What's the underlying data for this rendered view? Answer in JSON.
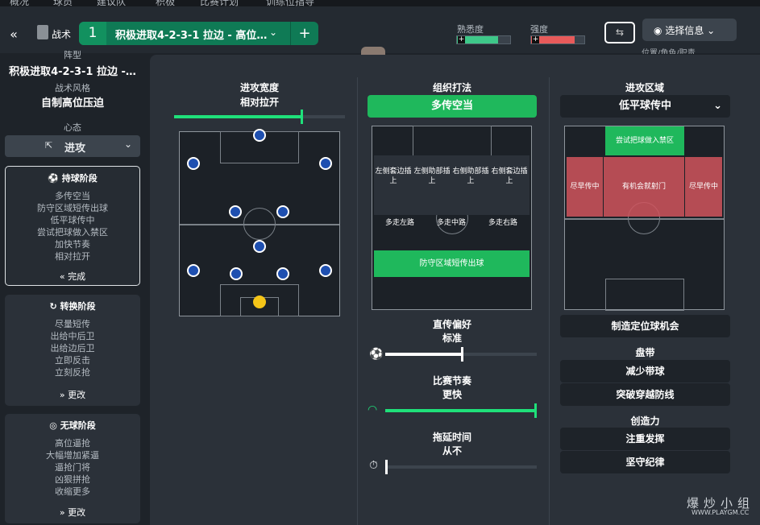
{
  "topnav": [
    "概况",
    "球员",
    "建议队",
    "积极",
    "比赛计划",
    "训练位指导"
  ],
  "toolbar": {
    "tactics_label": "战术",
    "tactic_number": "1",
    "tactic_name": "积极进取4-2-3-1 拉边 - 高位…",
    "familiarity_label": "熟悉度",
    "intensity_label": "强度",
    "select_info_label": "选择信息",
    "familiarity_fraction": 0.78,
    "intensity_fraction": 0.82,
    "right_subtitle": "位置/角色/职责"
  },
  "colors": {
    "accent": "#1fb85c",
    "dark_green": "#0f7a55",
    "red": "#d0545d",
    "blue": "#1e4fb0",
    "gk": "#f5c518"
  },
  "sidebar": {
    "formation_label": "阵型",
    "formation_value": "积极进取4-2-3-1 拉边 -…",
    "style_label": "战术风格",
    "style_value": "自制高位压迫",
    "mentality_label": "心态",
    "mentality_value": "进攻",
    "phases": [
      {
        "title": "持球阶段",
        "items": [
          "多传空当",
          "防守区域短传出球",
          "低平球传中",
          "尝试把球做入禁区",
          "加快节奏",
          "相对拉开"
        ],
        "button": "完成"
      },
      {
        "title": "转换阶段",
        "items": [
          "尽量短传",
          "出给中后卫",
          "出给边后卫",
          "立即反击",
          "立刻反抢"
        ],
        "button": "更改"
      },
      {
        "title": "无球阶段",
        "items": [
          "高位逼抢",
          "大幅增加紧逼",
          "逼抢门将",
          "凶狠拼抢",
          "收缩更多"
        ],
        "button": "更改"
      }
    ]
  },
  "width": {
    "header": "进攻宽度",
    "value": "相对拉开",
    "level": 0.74
  },
  "build": {
    "header": "组织打法",
    "value": "多传空当",
    "grid": [
      "左侧套边插上",
      "左侧助部插上",
      "右侧助部插上",
      "右侧套边插上"
    ],
    "mid": [
      "多走左路",
      "多走中路",
      "多走右路"
    ],
    "bottom": "防守区域短传出球"
  },
  "direct": {
    "header": "直传偏好",
    "value": "标准",
    "level": 0.5
  },
  "tempo": {
    "header": "比赛节奏",
    "value": "更快",
    "level": 1.0
  },
  "timewaste": {
    "header": "拖延时间",
    "value": "从不",
    "level": 0.0
  },
  "attack": {
    "header": "进攻区域",
    "value": "低平球传中",
    "top": "尝试把球做入禁区",
    "left": "尽早传中",
    "center": "有机会就射门",
    "right": "尽早传中",
    "setpiece": "制造定位球机会",
    "dribble_header": "盘带",
    "dribble_value": "减少带球",
    "dribble2": "突破穿越防线",
    "creative_header": "创造力",
    "creative_value": "注重发挥",
    "creative2": "坚守纪律"
  },
  "watermark": {
    "main": "爆炒小组",
    "sub": "WWW.PLAYGM.CC"
  }
}
